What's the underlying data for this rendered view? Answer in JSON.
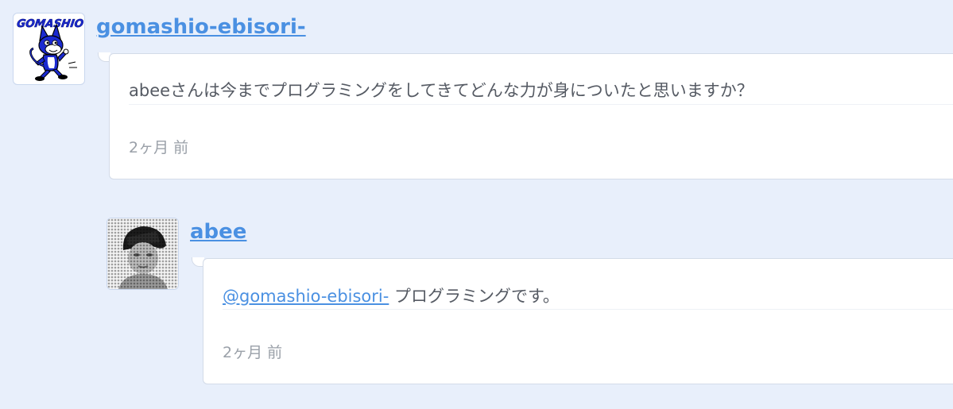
{
  "comments": [
    {
      "username": "gomashio-ebisori-",
      "avatar_logo_text": "GOMASHIO",
      "text": "abeeさんは今までプログラミングをしてきてどんな力が身についたと思いますか？",
      "timestamp": "2ヶ月 前"
    },
    {
      "username": "abee",
      "mention": "@gomashio-ebisori-",
      "text": " プログラミングです。",
      "timestamp": "2ヶ月 前"
    }
  ],
  "colors": {
    "background": "#e8effb",
    "link": "#4a90e2",
    "text": "#555a63",
    "muted": "#9aa0a8",
    "border": "#d3dbe8"
  },
  "icons": {
    "comment_1_avatar": "cartoon-cat-avatar",
    "comment_2_avatar": "pixelated-person-avatar"
  }
}
